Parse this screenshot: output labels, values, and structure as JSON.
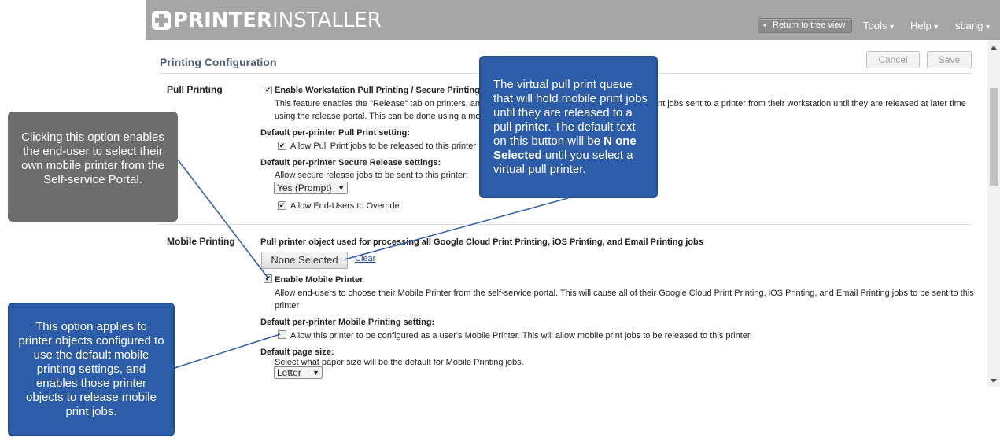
{
  "header": {
    "logo_bold": "PRINTER",
    "logo_normal": "INSTALLER",
    "return_button": "Return to tree view",
    "menus": [
      "Tools",
      "Help",
      "sbang"
    ],
    "caret": "▾"
  },
  "page": {
    "title": "Printing Configuration",
    "cancel": "Cancel",
    "save": "Save"
  },
  "pull": {
    "label": "Pull Printing",
    "enable": "Enable Workstation Pull Printing / Secure Printing",
    "desc1_a": "This feature enables the \"Release\" tab on printers, and",
    "desc1_b": "nt jobs sent to a printer from their workstation until they are released at later time",
    "desc2": "using the release portal. This can be done using a mob",
    "default_pull_label": "Default per-printer Pull Print setting:",
    "allow_pull": "Allow Pull Print jobs to be released to this printer",
    "default_secure_label": "Default per-printer Secure Release settings:",
    "allow_secure": "Allow secure release jobs to be sent to this printer:",
    "secure_select": "Yes (Prompt)",
    "allow_override": "Allow End-Users to Override"
  },
  "mobile": {
    "label": "Mobile Printing",
    "heading": "Pull printer object used for processing all Google Cloud Print Printing, iOS Printing, and Email Printing jobs",
    "none_selected": "None Selected",
    "clear": "Clear",
    "enable": "Enable Mobile Printer",
    "enable_desc1": "Allow end-users to choose their Mobile Printer from the self-service portal. This will cause all of their Google Cloud Print Printing, iOS Printing, and Email Printing jobs to be sent to this",
    "enable_desc2": "printer",
    "default_label": "Default per-printer Mobile Printing setting:",
    "allow_mobile": "Allow this printer to be configured as a user's Mobile Printer. This will allow mobile print jobs to be released to this printer.",
    "page_size_label": "Default page size:",
    "page_size_desc": "Select what paper size will be the default for Mobile Printing jobs.",
    "page_size_select": "Letter"
  },
  "callouts": {
    "gray": "Clicking this option enables the end-user to select their own mobile printer from the Self-service Portal.",
    "blue1_a": "The virtual pull print queue that will hold mobile print jobs until they are released to a pull printer. The default text on this button will be ",
    "blue1_b": "N one Selected",
    "blue1_c": " until you select a virtual pull printer.",
    "blue2": "This option applies to printer objects configured to use the default mobile printing settings, and enables those printer objects to release mobile print jobs."
  },
  "colors": {
    "header": "#a6a6a6",
    "callout_blue": "#2d5ca8",
    "callout_gray": "#6d6d6d",
    "section_title": "#4d5d73"
  }
}
